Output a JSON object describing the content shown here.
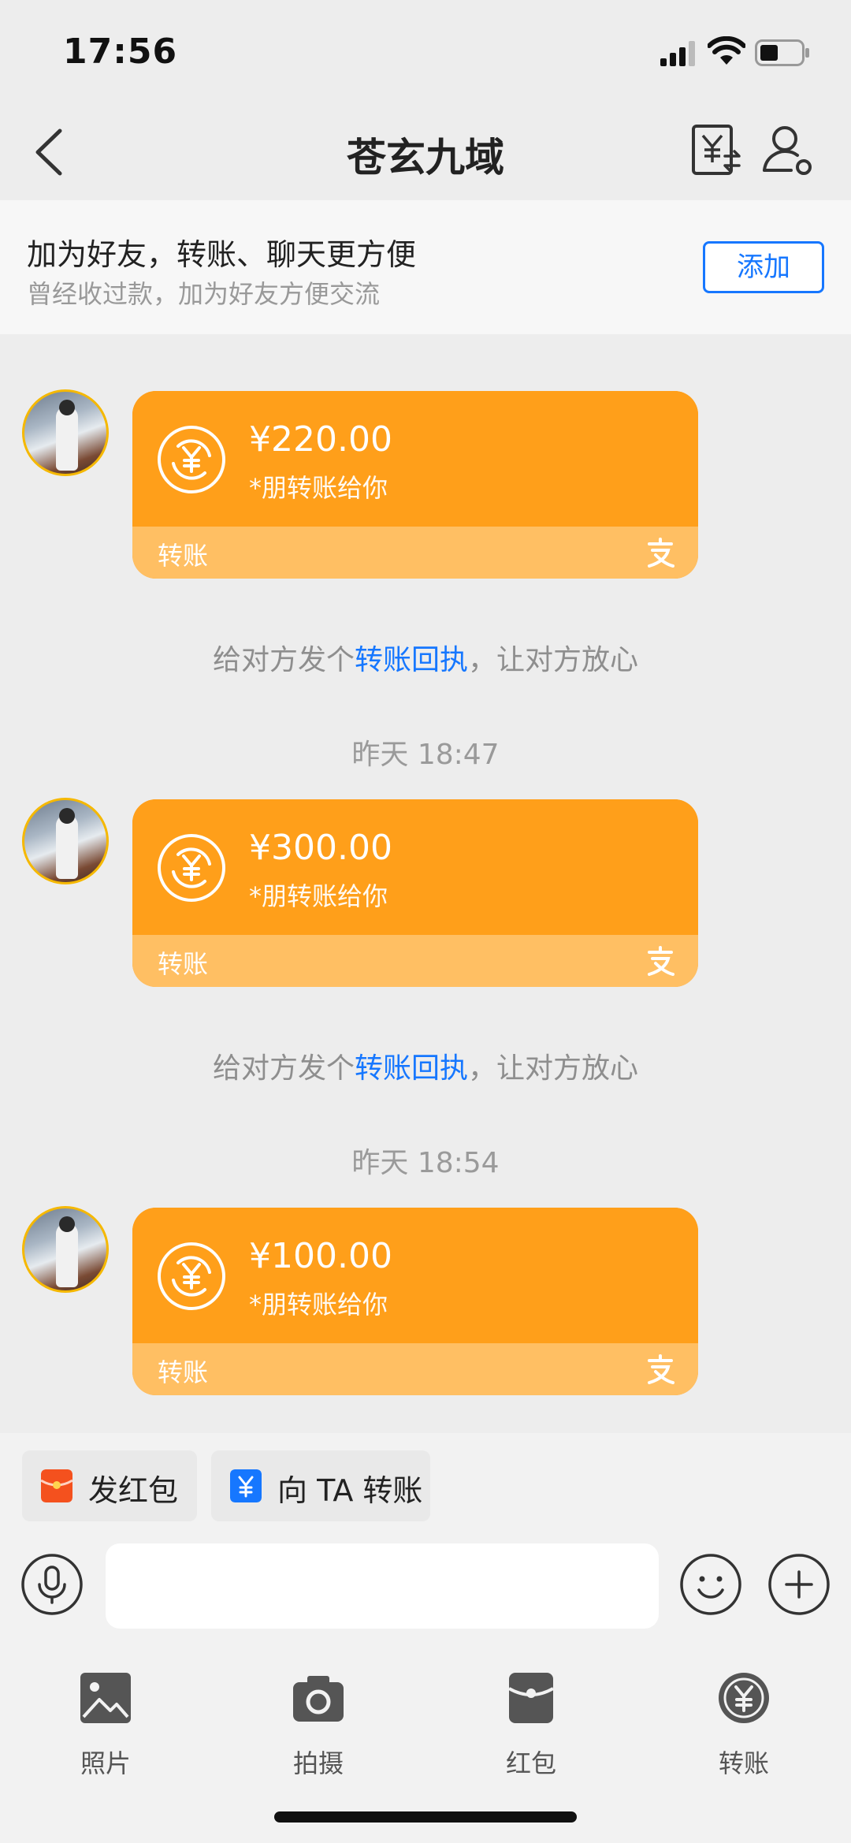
{
  "status_bar": {
    "time": "17:56"
  },
  "nav": {
    "title": "苍玄九域"
  },
  "banner": {
    "title": "加为好友，转账、聊天更方便",
    "subtitle": "曾经收过款，加为好友方便交流",
    "add_label": "添加"
  },
  "messages": [
    {
      "amount": "¥220.00",
      "from": "*朋转账给你",
      "label": "转账"
    },
    {
      "amount": "¥300.00",
      "from": "*朋转账给你",
      "label": "转账"
    },
    {
      "amount": "¥100.00",
      "from": "*朋转账给你",
      "label": "转账"
    }
  ],
  "hints": [
    {
      "prefix": "给对方发个",
      "link": "转账回执",
      "suffix": "，让对方放心"
    },
    {
      "prefix": "给对方发个",
      "link": "转账回执",
      "suffix": "，让对方放心"
    }
  ],
  "timestamps": [
    "昨天 18:47",
    "昨天 18:54"
  ],
  "quick_actions": [
    {
      "label": "发红包",
      "icon": "red-envelope-icon"
    },
    {
      "label": "向 TA 转账",
      "icon": "transfer-icon"
    }
  ],
  "input": {
    "value": "",
    "placeholder": ""
  },
  "tools": [
    {
      "label": "照片",
      "icon": "photo-icon"
    },
    {
      "label": "拍摄",
      "icon": "camera-icon"
    },
    {
      "label": "红包",
      "icon": "red-packet-icon"
    },
    {
      "label": "转账",
      "icon": "transfer-circle-icon"
    }
  ],
  "colors": {
    "accent": "#1677ff",
    "card": "#ff9f1a",
    "card_footer": "#ffbf63",
    "background": "#ededed"
  }
}
